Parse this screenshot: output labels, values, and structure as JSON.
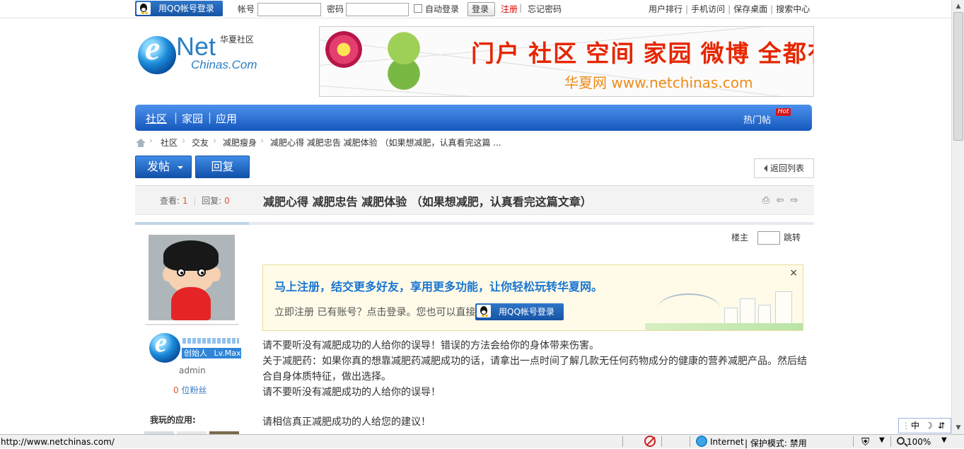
{
  "topbar": {
    "qq_login_label": "用QQ帐号登录",
    "account_label": "帐号",
    "password_label": "密码",
    "auto_login_label": "自动登录",
    "login_button": "登录",
    "register_link": "注册",
    "forgot_password_link": "忘记密码",
    "right_links": [
      "用户排行",
      "手机访问",
      "保存桌面",
      "搜索中心"
    ]
  },
  "header": {
    "site_label": "华夏社区",
    "logo_text_net": "Net",
    "logo_text_chinas": "Chinas.Com",
    "banner_slogan": "门户 社区 空间 家园 微博 全都有",
    "banner_site": "华夏网 www.netchinas.com"
  },
  "nav": {
    "items": [
      "社区",
      "家园",
      "应用"
    ],
    "hot_label": "热门帖",
    "hot_badge": "Hot"
  },
  "breadcrumb": {
    "items": [
      "社区",
      "交友",
      "减肥瘦身",
      "减肥心得 减肥忠告 减肥体验 （如果想减肥，认真看完这篇 ..."
    ]
  },
  "actions": {
    "post_button": "发帖",
    "reply_button": "回复",
    "back_list_button": "返回列表"
  },
  "thread": {
    "views_label": "查看:",
    "views_value": "1",
    "replies_label": "回复:",
    "replies_value": "0",
    "title": "减肥心得 减肥忠告 减肥体验 （如果想减肥，认真看完这篇文章）"
  },
  "author": {
    "rank_label": "创始人",
    "level_label": "Lv.Max",
    "name": "admin",
    "fans_value": "0",
    "fans_label": "位粉丝",
    "apps_label": "我玩的应用:"
  },
  "post": {
    "floor_label": "楼主",
    "jump_label": "跳转",
    "paragraphs": [
      "请不要听没有减肥成功的人给你的误导！错误的方法会给你的身体带来伤害。",
      "关于减肥药：如果你真的想靠减肥药减肥成功的话，请拿出一点时间了解几款无任何药物成分的健康的营养减肥产品。然后结合自身体质特征，做出选择。",
      "请不要听没有减肥成功的人给你的误导！",
      "",
      "请相信真正减肥成功的人给您的建议！"
    ]
  },
  "notice": {
    "title": "马上注册，结交更多好友，享用更多功能，让你轻松玩转华夏网。",
    "text": "立即注册 已有账号？点击登录。您也可以直接",
    "qq_button": "用QQ帐号登录"
  },
  "statusbar": {
    "url": "http://www.netchinas.com/",
    "zone": "Internet",
    "protected_mode": "保护模式: 禁用",
    "zoom": "100%"
  },
  "ime": {
    "label": "中"
  }
}
